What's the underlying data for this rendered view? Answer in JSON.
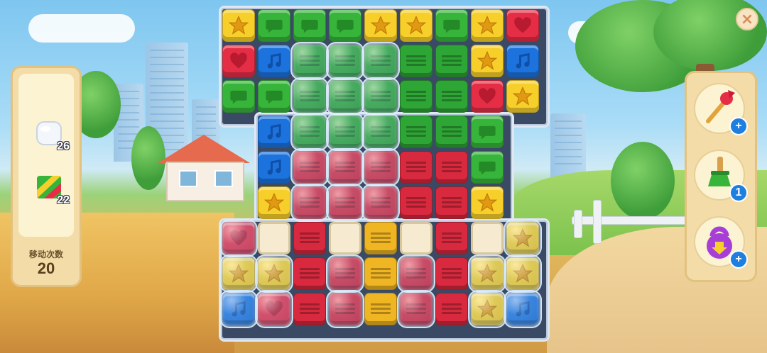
{
  "goals": [
    {
      "name": "bubble",
      "count": "26"
    },
    {
      "name": "crate",
      "count": "22"
    }
  ],
  "moves": {
    "label": "移动次数",
    "value": "20"
  },
  "boosters": [
    {
      "name": "dart",
      "badge": "+"
    },
    {
      "name": "broom",
      "badge": "1"
    },
    {
      "name": "kettlebell",
      "badge": "+"
    }
  ],
  "close_label": "×",
  "colors": {
    "yellow": "#f7cf2a",
    "green": "#37b43a",
    "red": "#e52e46",
    "blue": "#1c73dd",
    "panel": "#f3dca8",
    "badge": "#1f7fe0"
  },
  "board": {
    "rows": [
      [
        "Y*",
        "Gc",
        "Gc",
        "Gc",
        "Y*",
        "Y*",
        "Gc",
        "Y*",
        "Rh"
      ],
      [
        "Rh",
        "Bn",
        "GX",
        "GX",
        "GX",
        "GX",
        "GX",
        "Y*",
        "Bn"
      ],
      [
        "Gc",
        "Gc",
        "GX",
        "GX",
        "GX",
        "GX",
        "GX",
        "Rh",
        "Y*"
      ],
      [
        "__",
        "Bn",
        "GX",
        "GX",
        "GX",
        "GX",
        "GX",
        "Gc",
        "__"
      ],
      [
        "__",
        "Bn",
        "RX",
        "RX",
        "RX",
        "RX",
        "RX",
        "Gc",
        "__"
      ],
      [
        "__",
        "Y*",
        "RX",
        "RX",
        "RX",
        "RX",
        "RX",
        "Y*",
        "__"
      ],
      [
        "Rh",
        "E",
        "RX",
        "E",
        "OX",
        "E",
        "RX",
        "E",
        "Y*"
      ],
      [
        "Y*",
        "Y*",
        "RX",
        "RX",
        "OX",
        "RX",
        "RX",
        "Y*",
        "Y*"
      ],
      [
        "Bn",
        "Rh",
        "RX",
        "RX",
        "OX",
        "RX",
        "RX",
        "Y*",
        "Bn"
      ]
    ],
    "bubbles": [
      [
        2,
        1
      ],
      [
        3,
        1
      ],
      [
        4,
        1
      ],
      [
        2,
        2
      ],
      [
        3,
        2
      ],
      [
        4,
        2
      ],
      [
        2,
        3
      ],
      [
        3,
        3
      ],
      [
        4,
        3
      ],
      [
        2,
        4
      ],
      [
        3,
        4
      ],
      [
        4,
        4
      ],
      [
        2,
        5
      ],
      [
        3,
        5
      ],
      [
        4,
        5
      ],
      [
        3,
        7
      ],
      [
        5,
        7
      ],
      [
        3,
        8
      ],
      [
        5,
        8
      ],
      [
        0,
        6
      ],
      [
        0,
        7
      ],
      [
        0,
        8
      ],
      [
        1,
        7
      ],
      [
        1,
        8
      ],
      [
        7,
        7
      ],
      [
        7,
        8
      ],
      [
        8,
        6
      ],
      [
        8,
        7
      ],
      [
        8,
        8
      ]
    ]
  }
}
